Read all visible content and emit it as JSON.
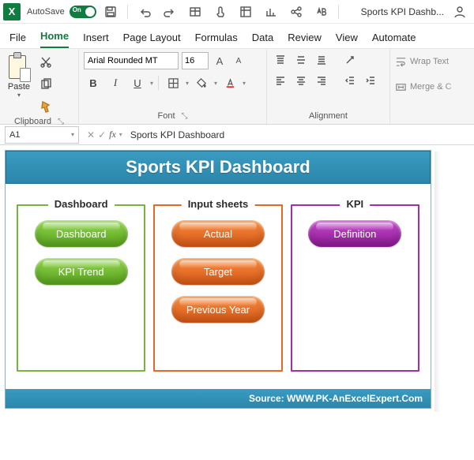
{
  "titlebar": {
    "autosave_label": "AutoSave",
    "autosave_state": "On",
    "doc_title": "Sports KPI Dashb..."
  },
  "tabs": [
    "File",
    "Home",
    "Insert",
    "Page Layout",
    "Formulas",
    "Data",
    "Review",
    "View",
    "Automate"
  ],
  "active_tab_index": 1,
  "ribbon": {
    "clipboard": {
      "paste_label": "Paste",
      "group_label": "Clipboard"
    },
    "font": {
      "font_name": "Arial Rounded MT",
      "font_size": "16",
      "bold": "B",
      "italic": "I",
      "underline": "U",
      "grow": "A",
      "shrink": "A",
      "group_label": "Font"
    },
    "alignment": {
      "group_label": "Alignment"
    },
    "wrap": {
      "wrap_label": "Wrap Text",
      "merge_label": "Merge & C"
    }
  },
  "formula_bar": {
    "cell_ref": "A1",
    "formula_value": "Sports KPI Dashboard"
  },
  "dashboard": {
    "title": "Sports KPI Dashboard",
    "panels": [
      {
        "legend": "Dashboard",
        "color": "green",
        "buttons": [
          "Dashboard",
          "KPI Trend"
        ]
      },
      {
        "legend": "Input sheets",
        "color": "orange",
        "buttons": [
          "Actual",
          "Target",
          "Previous Year"
        ]
      },
      {
        "legend": "KPI",
        "color": "purple",
        "buttons": [
          "Definition"
        ]
      }
    ],
    "footer": "Source: WWW.PK-AnExcelExpert.Com"
  }
}
